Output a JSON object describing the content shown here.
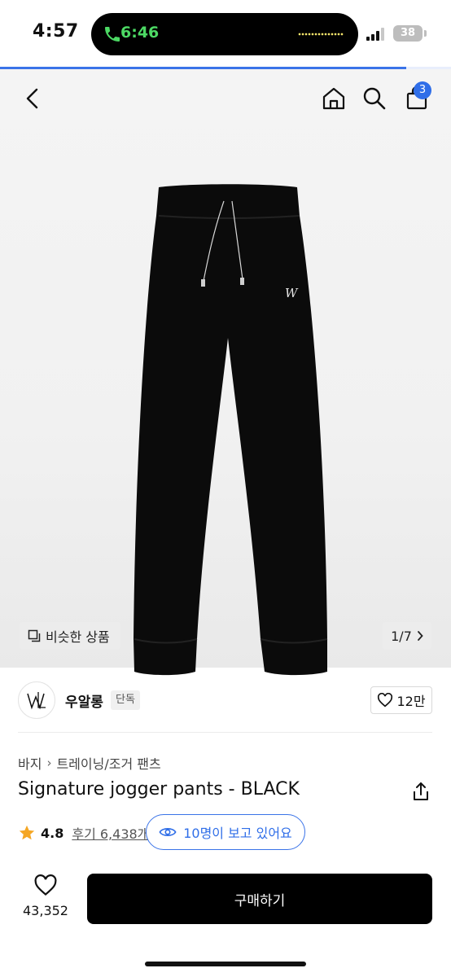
{
  "status_bar": {
    "time": "4:57",
    "call_time": "6:46",
    "battery": "38"
  },
  "page_progress": 0.9,
  "header": {
    "cart_count": "3"
  },
  "gallery": {
    "similar_label": "비슷한 상품",
    "pager_label": "1/7"
  },
  "brand": {
    "name": "우알롱",
    "tag": "단독",
    "likes": "12만"
  },
  "product": {
    "breadcrumb": [
      "바지",
      "트레이닝/조거 팬츠"
    ],
    "title": "Signature jogger pants - BLACK",
    "rating": "4.8",
    "reviews": "후기 6,438개",
    "viewers": "10명이 보고 있어요"
  },
  "bottom_bar": {
    "like_count": "43,352",
    "buy_label": "구매하기"
  },
  "colors": {
    "accent": "#2f6ee8",
    "call_green": "#4cd964",
    "star": "#f5a623",
    "buy_button": "#000000"
  },
  "icons": [
    "back-icon",
    "home-icon",
    "search-icon",
    "cart-icon",
    "similar-icon",
    "chevron-right-icon",
    "heart-icon",
    "share-icon",
    "star-icon",
    "eye-icon",
    "phone-icon"
  ]
}
